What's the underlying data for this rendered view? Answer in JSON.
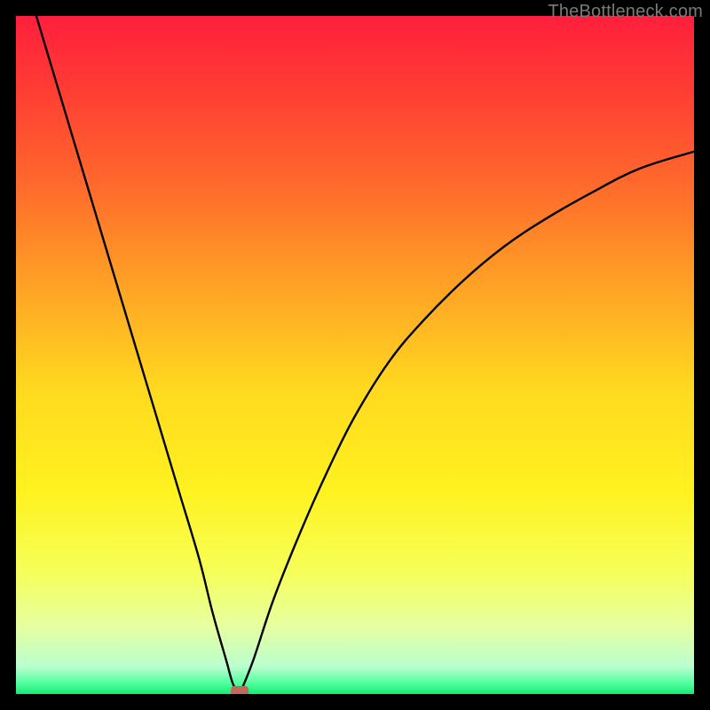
{
  "watermark": {
    "text": "TheBottleneck.com"
  },
  "gradient": {
    "stops": [
      {
        "offset": 0.0,
        "color": "#ff1f3c"
      },
      {
        "offset": 0.1,
        "color": "#ff3a34"
      },
      {
        "offset": 0.25,
        "color": "#ff6a2c"
      },
      {
        "offset": 0.4,
        "color": "#ffa325"
      },
      {
        "offset": 0.55,
        "color": "#ffd91f"
      },
      {
        "offset": 0.7,
        "color": "#fff21f"
      },
      {
        "offset": 0.82,
        "color": "#f6ff59"
      },
      {
        "offset": 0.9,
        "color": "#e6ffa0"
      },
      {
        "offset": 0.96,
        "color": "#b9ffcf"
      },
      {
        "offset": 0.985,
        "color": "#4dff9c"
      },
      {
        "offset": 1.0,
        "color": "#17e873"
      }
    ]
  },
  "chart_data": {
    "type": "line",
    "title": "",
    "xlabel": "",
    "ylabel": "",
    "xlim": [
      0,
      100
    ],
    "ylim": [
      0,
      100
    ],
    "minimum_marker": {
      "x": 33,
      "y": 0
    },
    "series": [
      {
        "name": "left-branch",
        "x": [
          3,
          6,
          9,
          12,
          15,
          18,
          21,
          24,
          27,
          29,
          31,
          32,
          33
        ],
        "y": [
          100,
          90,
          80,
          70,
          60,
          50,
          40,
          30,
          20,
          12,
          5,
          1.5,
          0
        ]
      },
      {
        "name": "right-branch",
        "x": [
          33,
          35,
          38,
          42,
          46,
          50,
          55,
          60,
          66,
          72,
          78,
          85,
          92,
          100
        ],
        "y": [
          0,
          5,
          14,
          24,
          33,
          41,
          49,
          55,
          61,
          66,
          70,
          74,
          77.5,
          80
        ]
      }
    ]
  }
}
